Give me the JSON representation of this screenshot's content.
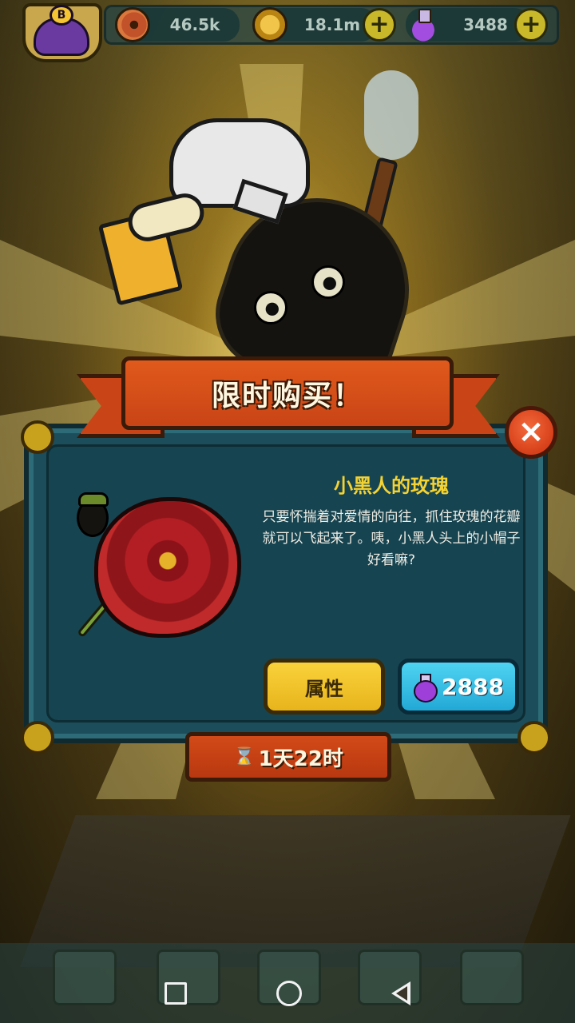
{
  "hud": {
    "eyes": "46.5k",
    "coins": "18.1m",
    "potions": "3488",
    "avatar_badge": "B"
  },
  "offer": {
    "title": "限时购买！",
    "item_name": "小黑人的玫瑰",
    "item_desc": "只要怀揣着对爱情的向往，抓住玫瑰的花瓣就可以飞起来了。咦，小黑人头上的小帽子好看嘛?",
    "attr_label": "属性",
    "price": "2888",
    "timer": "1天22时",
    "close_glyph": "×"
  },
  "icons": {
    "eye": "eyeball-icon",
    "coin": "coin-icon",
    "potion": "potion-icon",
    "hourglass": "hourglass-icon"
  },
  "colors": {
    "banner": "#c94416",
    "panel": "#1c4d5a",
    "name": "#f4d232",
    "buy": "#22a8d6",
    "attr": "#f9d23b"
  }
}
